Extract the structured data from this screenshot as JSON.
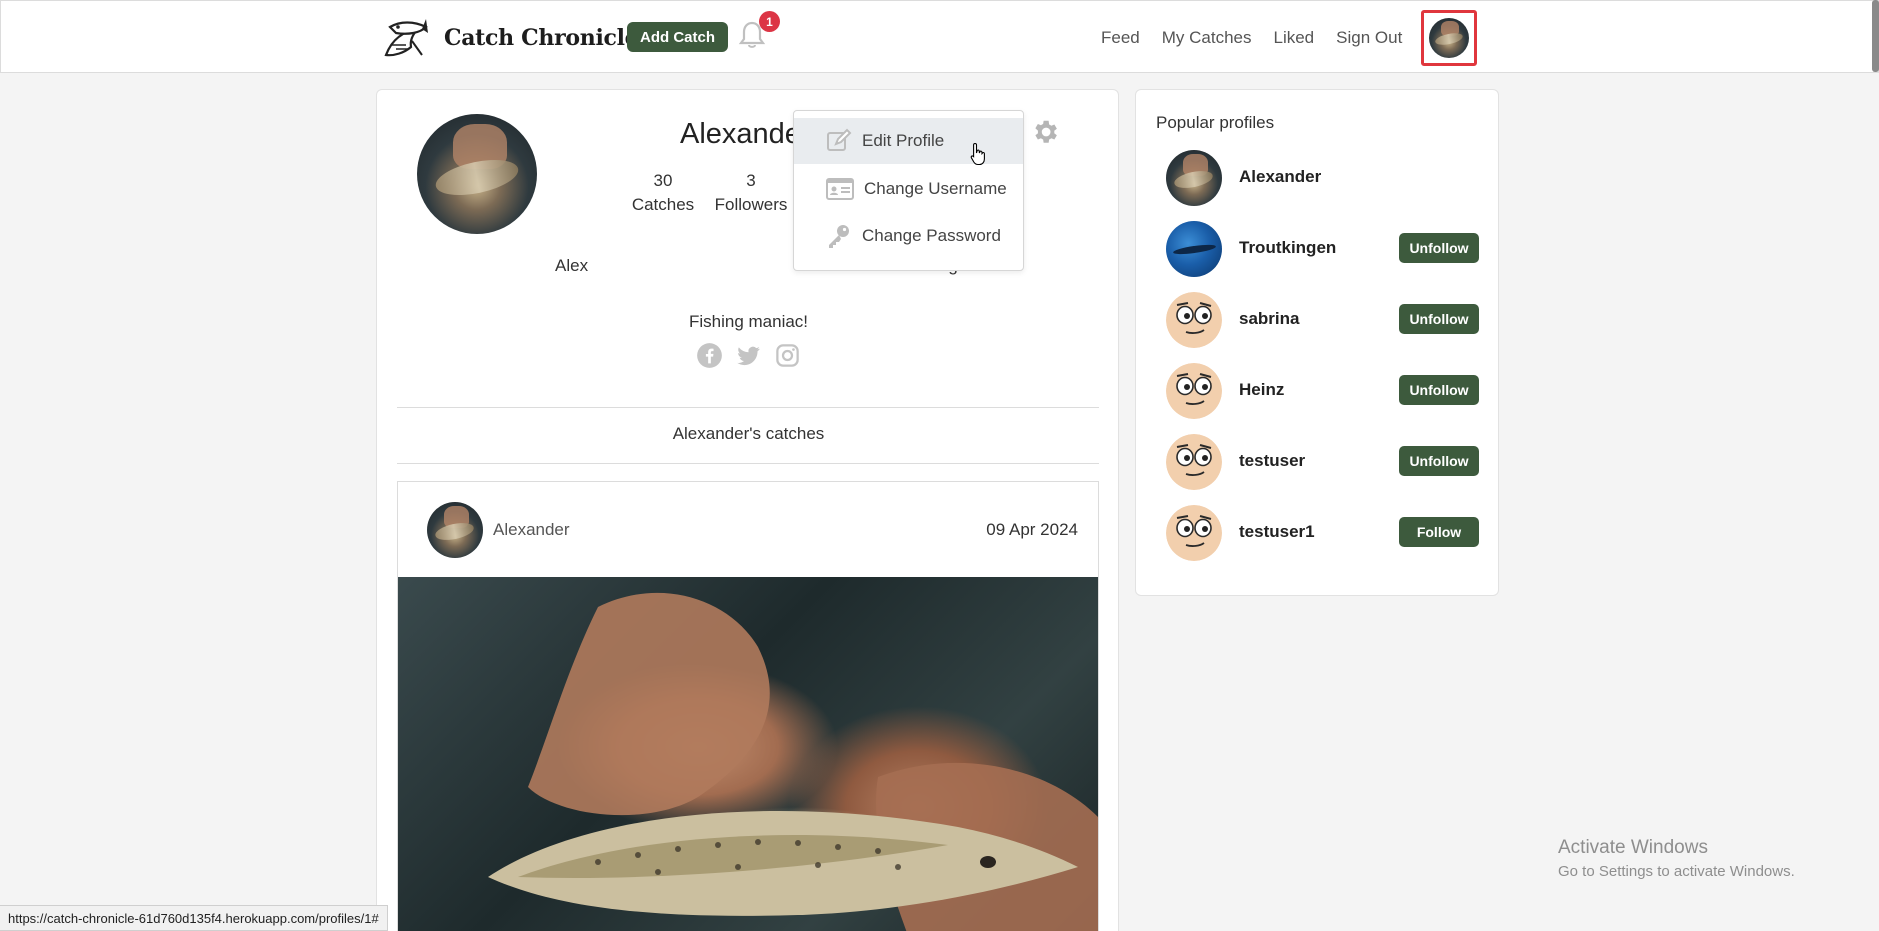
{
  "navbar": {
    "brand": "Catch Chronicle",
    "add_catch": "Add Catch",
    "notification_count": "1",
    "links": [
      "Feed",
      "My Catches",
      "Liked",
      "Sign Out"
    ]
  },
  "profile": {
    "name": "Alexander",
    "catches_count": "30",
    "catches_label": "Catches",
    "followers_count": "3",
    "followers_label": "Followers",
    "first_name": "Alex",
    "location": "Göteborg",
    "bio": "Fishing maniac!",
    "catches_heading": "Alexander's catches"
  },
  "dropdown": {
    "items": [
      {
        "label": "Edit Profile",
        "icon": "edit-icon"
      },
      {
        "label": "Change Username",
        "icon": "id-card-icon"
      },
      {
        "label": "Change Password",
        "icon": "key-icon"
      }
    ]
  },
  "post": {
    "author": "Alexander",
    "date": "09 Apr 2024"
  },
  "popular_profiles": {
    "title": "Popular profiles",
    "items": [
      {
        "name": "Alexander",
        "button": ""
      },
      {
        "name": "Troutkingen",
        "button": "Unfollow"
      },
      {
        "name": "sabrina",
        "button": "Unfollow"
      },
      {
        "name": "Heinz",
        "button": "Unfollow"
      },
      {
        "name": "testuser",
        "button": "Unfollow"
      },
      {
        "name": "testuser1",
        "button": "Follow"
      }
    ]
  },
  "statusbar": {
    "url": "https://catch-chronicle-61d760d135f4.herokuapp.com/profiles/1#"
  },
  "watermark": {
    "line1": "Activate Windows",
    "line2": "Go to Settings to activate Windows."
  },
  "colors": {
    "brand_button": "#3d5a3d",
    "badge": "#dc3545",
    "highlight_border": "#e0363d"
  }
}
